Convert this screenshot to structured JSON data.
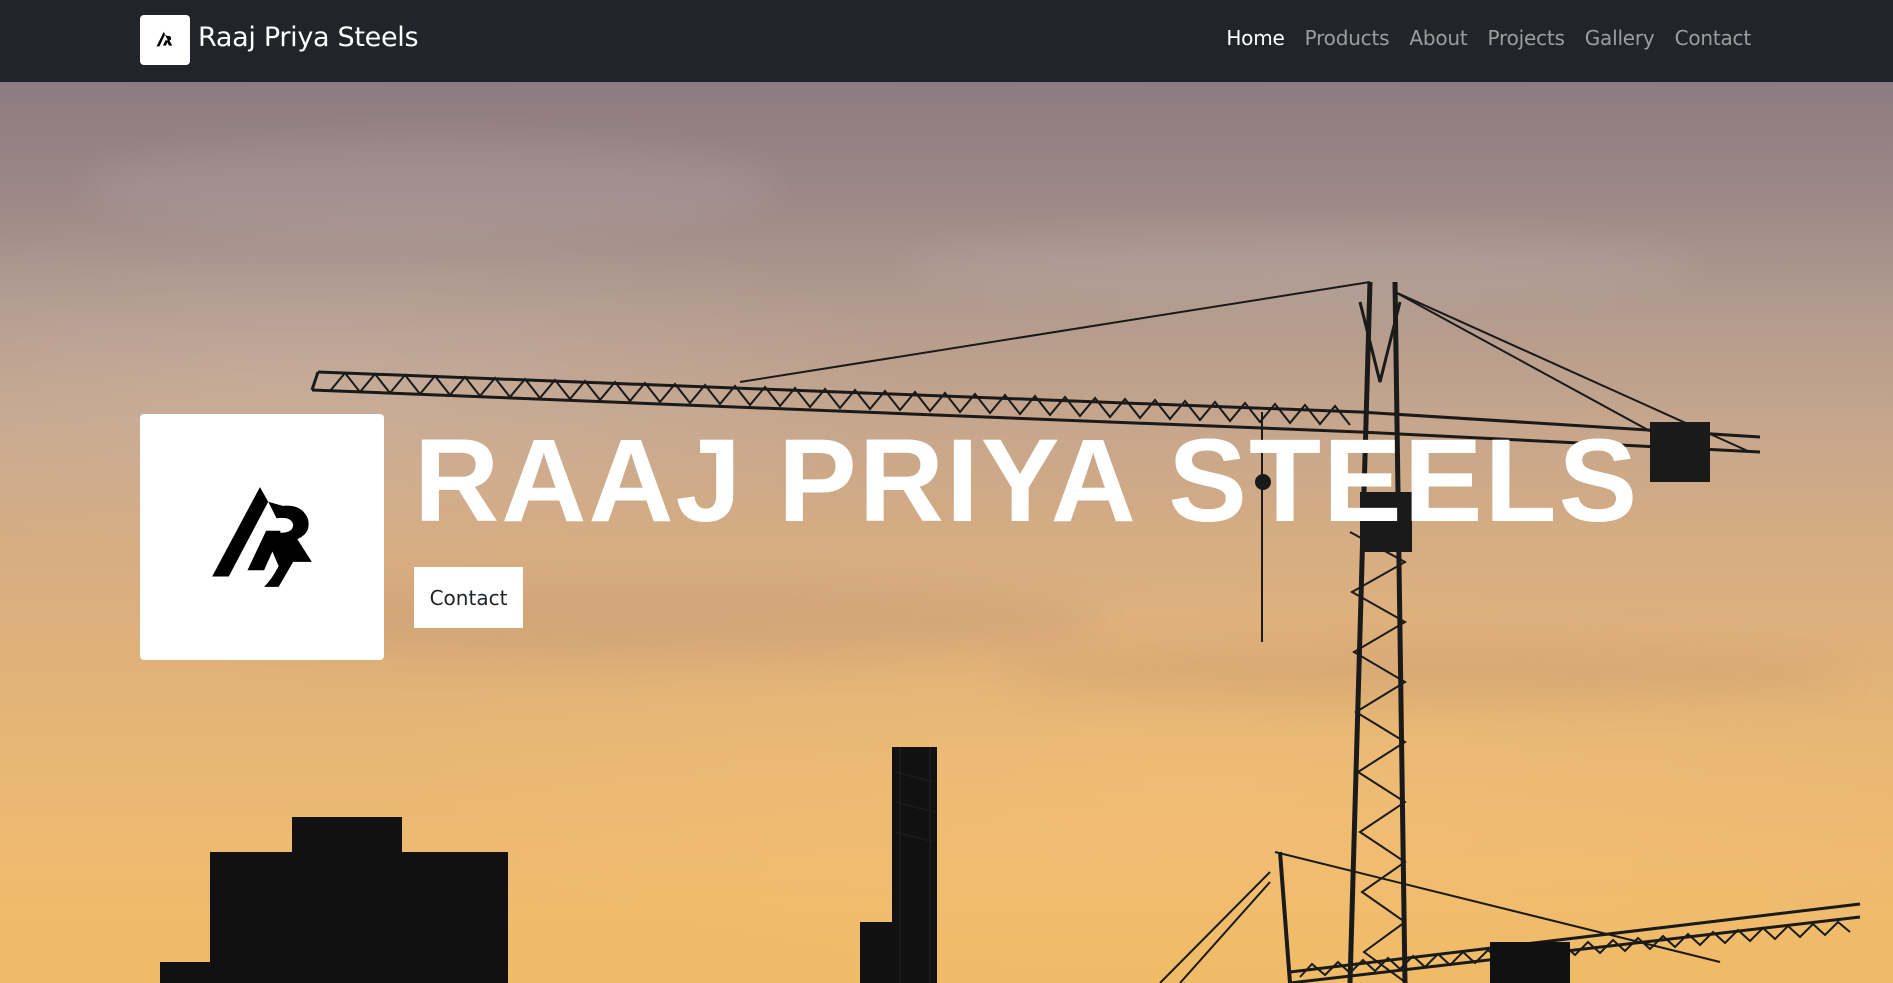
{
  "navbar": {
    "brand_name": "Raaj Priya Steels",
    "logo_icon": "rp-logo-icon",
    "background_color": "#212529",
    "links": [
      {
        "label": "Home",
        "active": true
      },
      {
        "label": "Products",
        "active": false
      },
      {
        "label": "About",
        "active": false
      },
      {
        "label": "Projects",
        "active": false
      },
      {
        "label": "Gallery",
        "active": false
      },
      {
        "label": "Contact",
        "active": false
      }
    ]
  },
  "hero": {
    "title": "RAAJ PRIYA STEELS",
    "button_label": "Contact",
    "logo_icon": "rp-logo-icon",
    "background_description_icon": "construction-crane-sunset-image"
  }
}
